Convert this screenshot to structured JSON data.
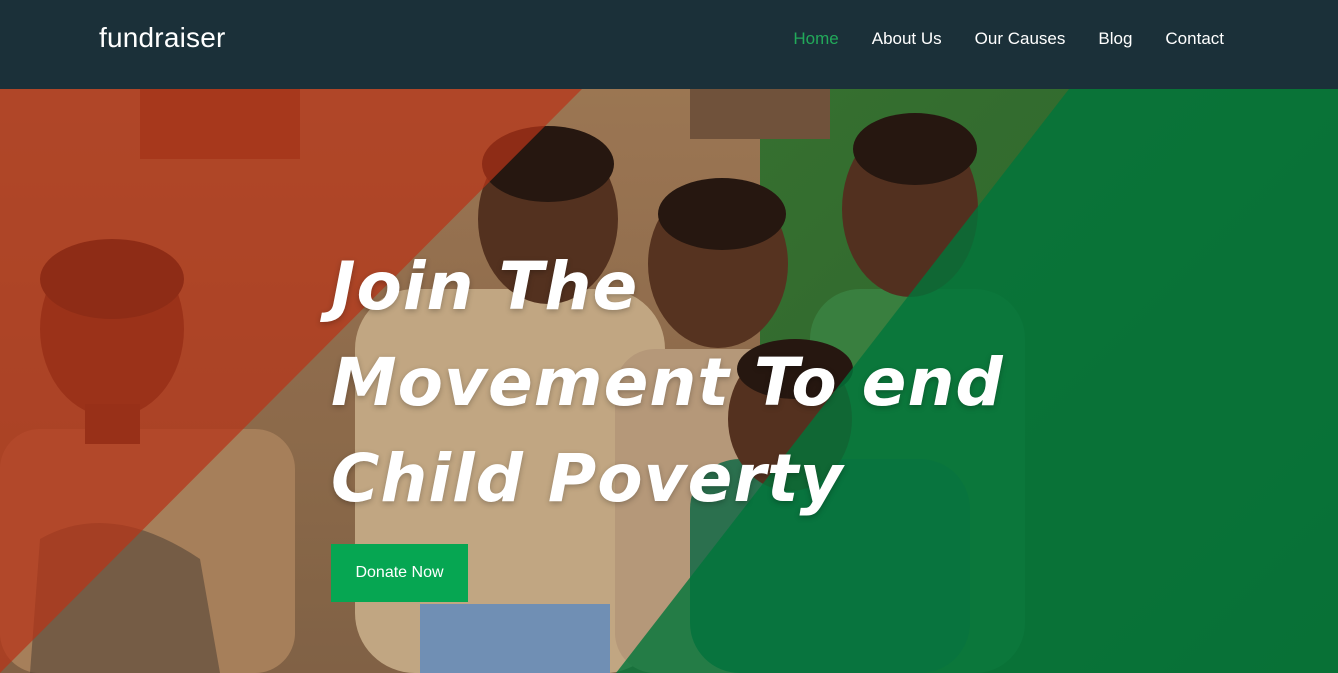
{
  "header": {
    "brand": "fundraiser",
    "nav": [
      {
        "label": "Home",
        "active": true
      },
      {
        "label": "About Us",
        "active": false
      },
      {
        "label": "Our Causes",
        "active": false
      },
      {
        "label": "Blog",
        "active": false
      },
      {
        "label": "Contact",
        "active": false
      }
    ]
  },
  "hero": {
    "title_lines": [
      "Join The",
      "Movement To end",
      "Child Poverty"
    ],
    "donate_label": "Donate Now",
    "image": "hero-children-photo",
    "overlay_colors": {
      "left": "#c8391a",
      "right": "#008040"
    }
  },
  "colors": {
    "header_bg": "#1b3039",
    "accent": "#22a95a",
    "button": "#06a652"
  }
}
